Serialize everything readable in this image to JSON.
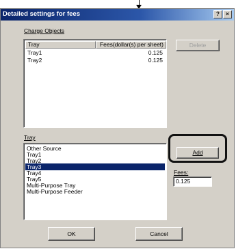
{
  "dialog": {
    "title": "Detailed settings for fees",
    "help_glyph": "?",
    "close_glyph": "×"
  },
  "charge_objects": {
    "label": "Charge Objects",
    "columns": [
      "Tray",
      "Fees(dollar(s) per sheet)"
    ],
    "rows": [
      {
        "tray": "Tray1",
        "fee": "0.125"
      },
      {
        "tray": "Tray2",
        "fee": "0.125"
      }
    ],
    "delete_button": "Delete"
  },
  "tray_section": {
    "label": "Tray",
    "items": [
      "Other Source",
      "Tray1",
      "Tray2",
      "Tray3",
      "Tray4",
      "Tray5",
      "Multi-Purpose Tray",
      "Multi-Purpose Feeder"
    ],
    "selected": "Tray3",
    "add_button": "Add",
    "fees_label": "Fees:",
    "fees_value": "0.125"
  },
  "buttons": {
    "ok": "OK",
    "cancel": "Cancel"
  },
  "colors": {
    "selection": "#0a246a",
    "dialog_bg": "#d4d0c8"
  }
}
